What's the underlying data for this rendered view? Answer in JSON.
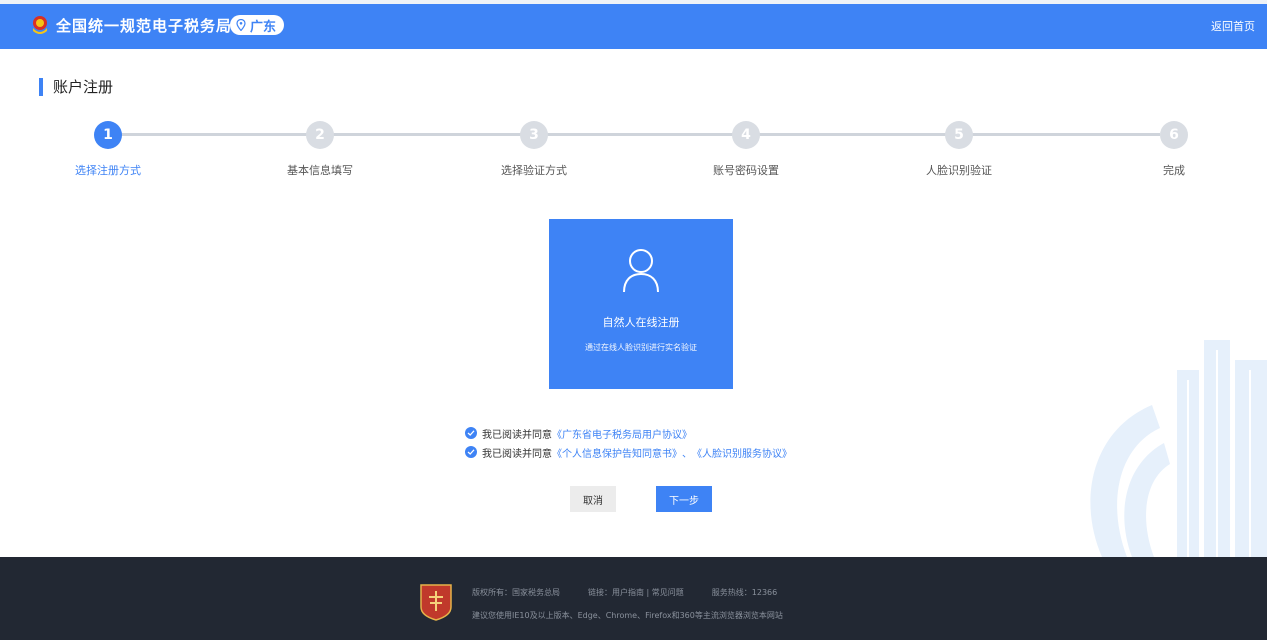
{
  "header": {
    "site_title": "全国统一规范电子税务局",
    "region": "广东",
    "home_link": "返回首页"
  },
  "page_title": "账户注册",
  "steps": [
    {
      "num": "1",
      "label": "选择注册方式",
      "active": true
    },
    {
      "num": "2",
      "label": "基本信息填写",
      "active": false
    },
    {
      "num": "3",
      "label": "选择验证方式",
      "active": false
    },
    {
      "num": "4",
      "label": "账号密码设置",
      "active": false
    },
    {
      "num": "5",
      "label": "人脸识别验证",
      "active": false
    },
    {
      "num": "6",
      "label": "完成",
      "active": false
    }
  ],
  "card": {
    "title": "自然人在线注册",
    "subtitle": "通过在线人脸识别进行实名验证",
    "icon": "user-icon"
  },
  "agreements": {
    "prefix": "我已阅读并同意",
    "first_link": "《广东省电子税务局用户协议》",
    "second_link_a": "《个人信息保护告知同意书》",
    "separator": "、",
    "second_link_b": "《人脸识别服务协议》"
  },
  "buttons": {
    "cancel": "取消",
    "next": "下一步"
  },
  "footer": {
    "copyright": "版权所有：国家税务总局",
    "links": "链接：用户指南 | 常见问题",
    "hotline": "服务热线：12366",
    "browser_tip": "建议您使用IE10及以上版本、Edge、Chrome、Firefox和360等主流浏览器浏览本网站"
  },
  "colors": {
    "brand": "#3e83f5",
    "footer_bg": "#222833",
    "step_inactive": "#d9dde3"
  }
}
